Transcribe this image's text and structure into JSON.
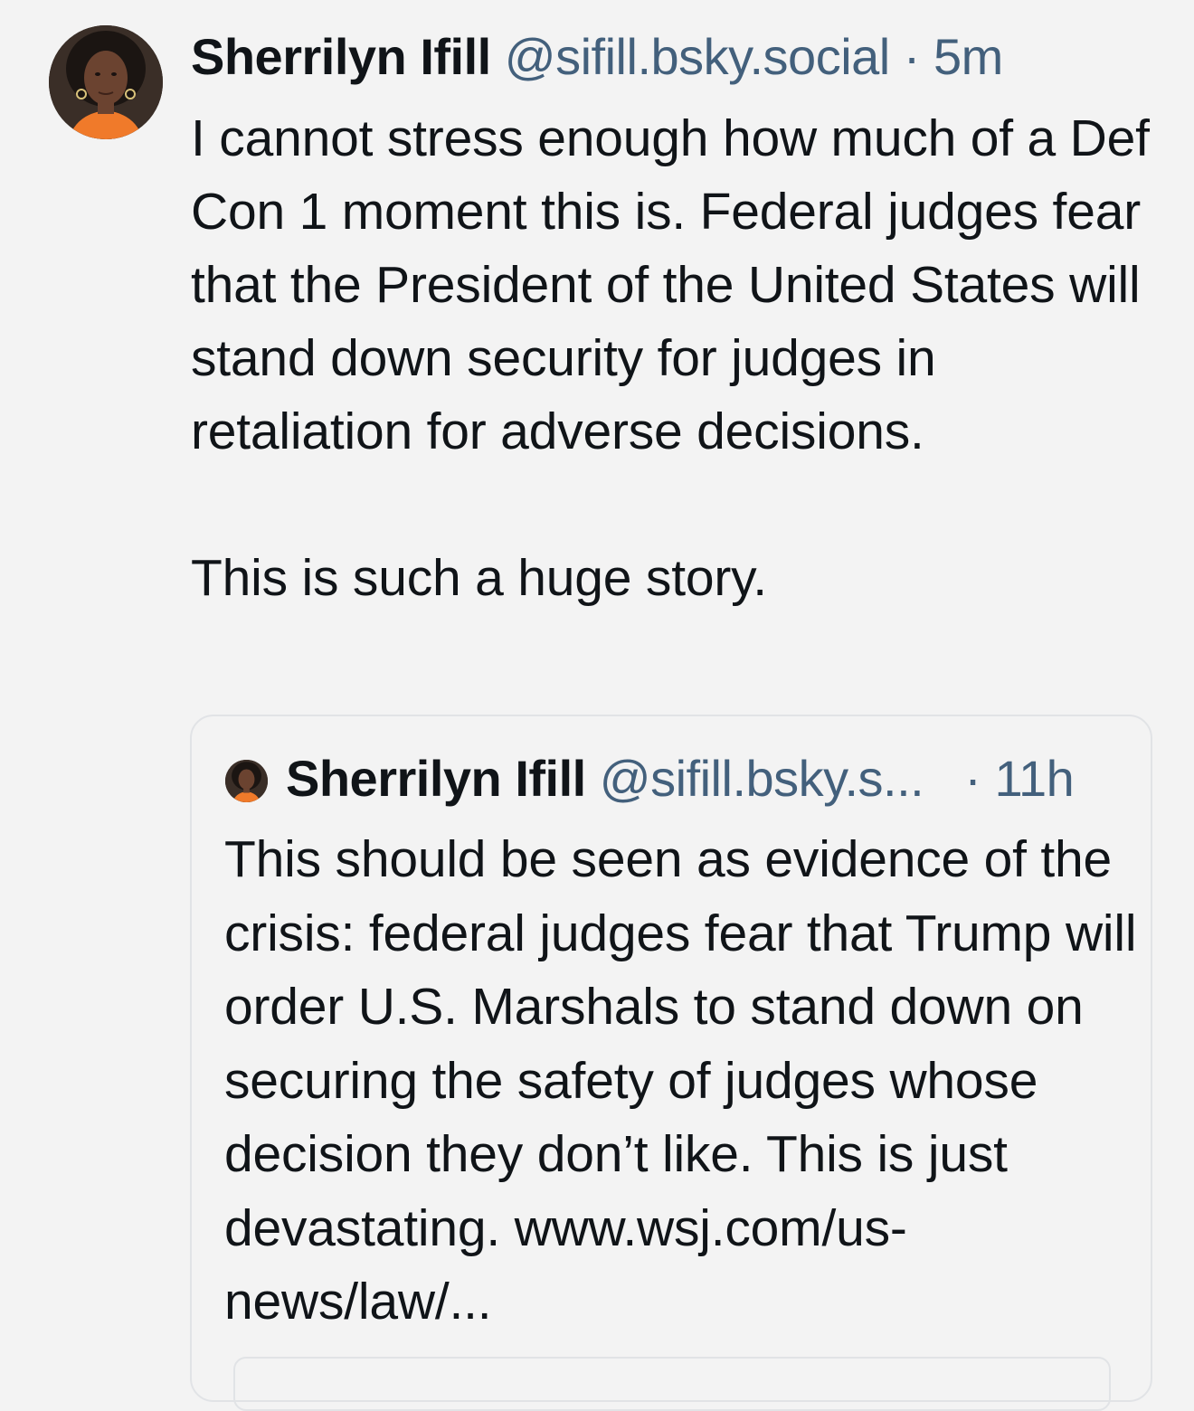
{
  "post": {
    "author_name": "Sherrilyn Ifill",
    "handle": "@sifill.bsky.social",
    "separator": "·",
    "time": "5m",
    "text": "I cannot stress enough how much of a Def Con 1 moment this is. Federal judges fear that the President of the United States will stand down security for judges in retaliation for adverse decisions.\n\nThis is such a huge story."
  },
  "quote": {
    "author_name": "Sherrilyn Ifill",
    "handle": "@sifill.bsky.s...",
    "separator": "·",
    "time": "11h",
    "text": "This should be seen as evidence of the crisis: federal judges fear that Trump will order U.S. Marshals to stand down on securing the safety of judges whose decision they don’t like. This is just devastating. www.wsj.com/us-news/law/..."
  },
  "colors": {
    "background": "#f3f3f3",
    "text": "#101418",
    "secondary_text": "#43607c",
    "border": "#e1e3e6"
  },
  "icons": {
    "avatar": "author-avatar",
    "quote_avatar": "quoted-author-avatar"
  }
}
